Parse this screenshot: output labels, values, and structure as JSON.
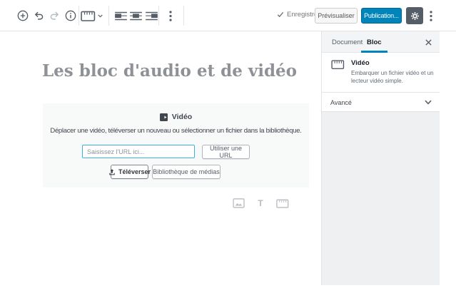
{
  "toolbar": {
    "saved_label": "Enregistré",
    "preview_label": "Prévisualiser",
    "publish_label": "Publication...",
    "icons": [
      "inserter",
      "undo",
      "redo",
      "info",
      "video-block-switcher",
      "align-left",
      "align-center",
      "align-right",
      "more-options",
      "settings-gear",
      "more-menu"
    ]
  },
  "sidebar": {
    "tabs": [
      {
        "label": "Document",
        "active": false
      },
      {
        "label": "Bloc",
        "active": true
      }
    ],
    "block_card": {
      "title": "Vidéo",
      "description": "Embarquer un fichier vidéo et un lecteur vidéo simple."
    },
    "advanced_label": "Avancé"
  },
  "editor": {
    "post_title": "Les bloc d'audio et de vidéo",
    "video_placeholder": {
      "title": "Vidéo",
      "instructions": "Déplacer une vidéo, téléverser un nouveau ou sélectionner un fichier dans la bibliothèque.",
      "url_placeholder": "Saisissez l'URL ici...",
      "use_url_label": "Utiliser une URL",
      "upload_label": "Téléverser",
      "media_library_label": "Bibliothèque de médias"
    },
    "appender_text_glyph": "T"
  },
  "colors": {
    "accent_blue": "#0085ba",
    "publish_button_bg": "#0085ba",
    "toolbar_icon": "#555d66",
    "border": "#e2e4e7",
    "placeholder_bg": "#f8f9f9",
    "sidebar_panel_bg": "#eef0f1",
    "input_focus_border": "#3db1d8",
    "post_title_gray": "#8e9196",
    "disabled_icon": "#b5bcc2"
  }
}
